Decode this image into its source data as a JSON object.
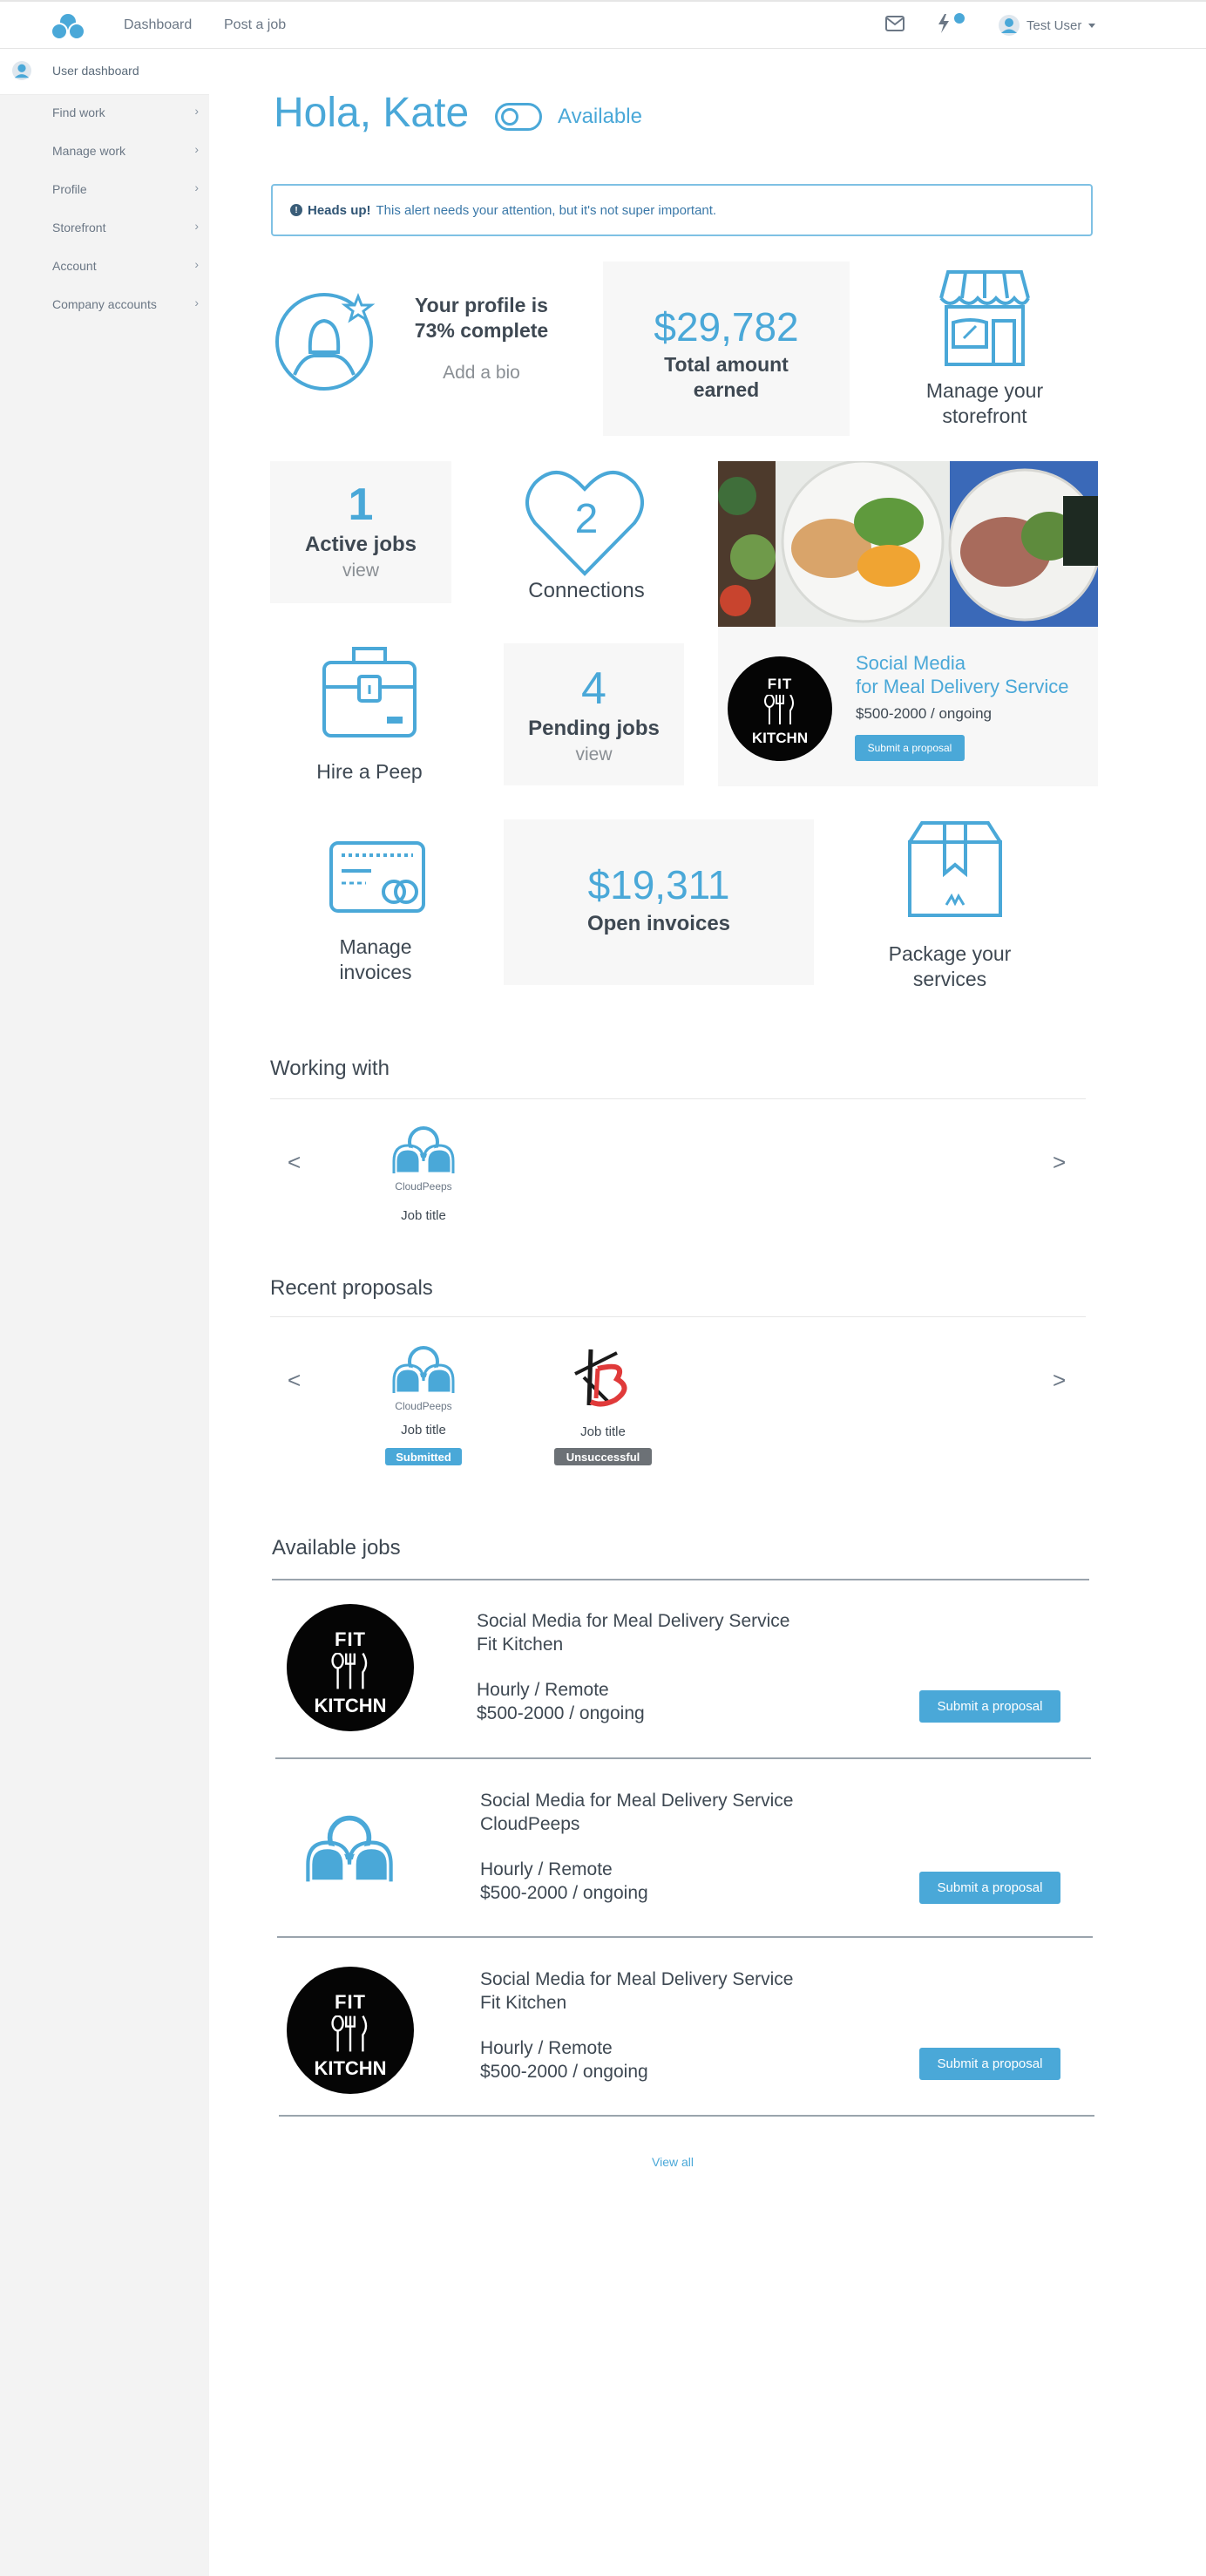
{
  "nav": {
    "dashboard": "Dashboard",
    "post_job": "Post a job",
    "user": "Test User"
  },
  "sidebar": {
    "header": "User dashboard",
    "items": [
      {
        "label": "Find work"
      },
      {
        "label": "Manage work"
      },
      {
        "label": "Profile"
      },
      {
        "label": "Storefront"
      },
      {
        "label": "Account"
      },
      {
        "label": "Company accounts"
      }
    ]
  },
  "hero": {
    "greeting": "Hola, Kate",
    "availability": "Available"
  },
  "alert": {
    "strong": "Heads up!",
    "text": "This alert needs your attention, but it's not super important."
  },
  "profile": {
    "line1": "Your profile is",
    "line2": "73% complete",
    "progress_percent": 73,
    "action": "Add a bio"
  },
  "earned": {
    "amount": "$29,782",
    "line1": "Total amount",
    "line2": "earned"
  },
  "storefront": {
    "line1": "Manage your",
    "line2": "storefront"
  },
  "active_jobs": {
    "count": "1",
    "label": "Active jobs",
    "action": "view"
  },
  "connections": {
    "count": "2",
    "label": "Connections"
  },
  "hire": {
    "label": "Hire a Peep"
  },
  "pending_jobs": {
    "count": "4",
    "label": "Pending jobs",
    "action": "view"
  },
  "featured": {
    "title1": "Social Media",
    "title2": "for Meal Delivery Service",
    "price": "$500-2000 / ongoing",
    "button": "Submit a proposal",
    "logo_top": "FIT",
    "logo_bottom": "KITCHN"
  },
  "invoices": {
    "line1": "Manage",
    "line2": "invoices"
  },
  "open_invoices": {
    "amount": "$19,311",
    "label": "Open invoices"
  },
  "package": {
    "line1": "Package your",
    "line2": "services"
  },
  "working_with": {
    "title": "Working with",
    "prev": "<",
    "next": ">",
    "items": [
      {
        "company": "CloudPeeps",
        "job": "Job title"
      }
    ]
  },
  "recent_proposals": {
    "title": "Recent proposals",
    "prev": "<",
    "next": ">",
    "items": [
      {
        "company": "CloudPeeps",
        "job": "Job title",
        "status": "Submitted"
      },
      {
        "company": "",
        "job": "Job title",
        "status": "Unsuccessful"
      }
    ]
  },
  "available_jobs": {
    "title": "Available jobs",
    "view_all": "View all",
    "jobs": [
      {
        "title": "Social Media for Meal Delivery Service",
        "company": "Fit Kitchen",
        "type": "Hourly / Remote",
        "price": "$500-2000 / ongoing",
        "button": "Submit a proposal",
        "logo_top": "FIT",
        "logo_bottom": "KITCHN"
      },
      {
        "title": "Social Media for Meal Delivery Service",
        "company": "CloudPeeps",
        "type": "Hourly / Remote",
        "price": "$500-2000 / ongoing",
        "button": "Submit a proposal"
      },
      {
        "title": "Social Media for Meal Delivery Service",
        "company": "Fit Kitchen",
        "type": "Hourly / Remote",
        "price": "$500-2000 / ongoing",
        "button": "Submit a proposal",
        "logo_top": "FIT",
        "logo_bottom": "KITCHN"
      }
    ]
  },
  "colors": {
    "accent": "#4aa8d8",
    "submitted": "#4aa8d8",
    "unsuccessful": "#6c7176",
    "sidebar": "#f3f3f3"
  }
}
